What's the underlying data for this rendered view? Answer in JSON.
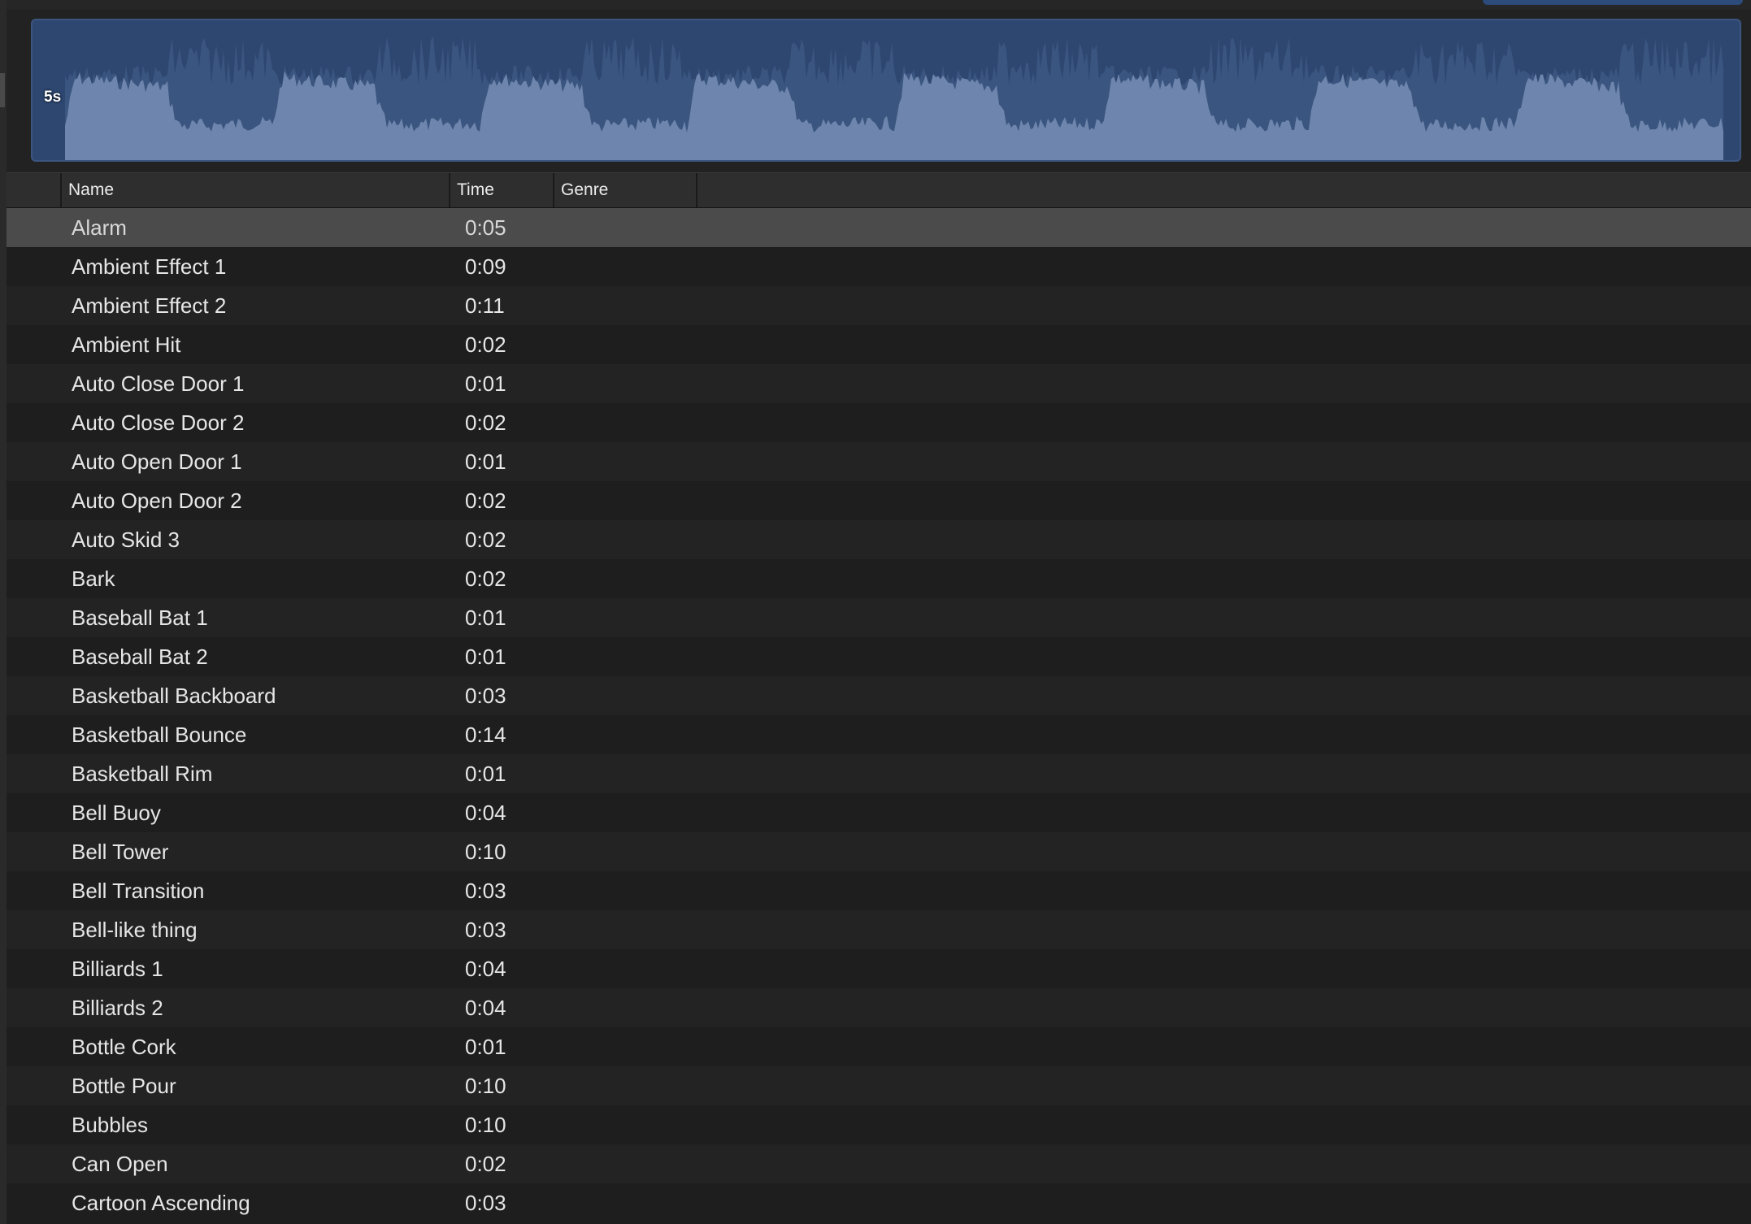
{
  "preview": {
    "duration_label": "5s"
  },
  "columns": {
    "name": "Name",
    "time": "Time",
    "genre": "Genre"
  },
  "selected_index": 0,
  "rows": [
    {
      "name": "Alarm",
      "time": "0:05",
      "genre": ""
    },
    {
      "name": "Ambient Effect 1",
      "time": "0:09",
      "genre": ""
    },
    {
      "name": "Ambient Effect 2",
      "time": "0:11",
      "genre": ""
    },
    {
      "name": "Ambient Hit",
      "time": "0:02",
      "genre": ""
    },
    {
      "name": "Auto Close Door 1",
      "time": "0:01",
      "genre": ""
    },
    {
      "name": "Auto Close Door 2",
      "time": "0:02",
      "genre": ""
    },
    {
      "name": "Auto Open Door 1",
      "time": "0:01",
      "genre": ""
    },
    {
      "name": "Auto Open Door 2",
      "time": "0:02",
      "genre": ""
    },
    {
      "name": "Auto Skid 3",
      "time": "0:02",
      "genre": ""
    },
    {
      "name": "Bark",
      "time": "0:02",
      "genre": ""
    },
    {
      "name": "Baseball Bat 1",
      "time": "0:01",
      "genre": ""
    },
    {
      "name": "Baseball Bat 2",
      "time": "0:01",
      "genre": ""
    },
    {
      "name": "Basketball Backboard",
      "time": "0:03",
      "genre": ""
    },
    {
      "name": "Basketball Bounce",
      "time": "0:14",
      "genre": ""
    },
    {
      "name": "Basketball Rim",
      "time": "0:01",
      "genre": ""
    },
    {
      "name": "Bell Buoy",
      "time": "0:04",
      "genre": ""
    },
    {
      "name": "Bell Tower",
      "time": "0:10",
      "genre": ""
    },
    {
      "name": "Bell Transition",
      "time": "0:03",
      "genre": ""
    },
    {
      "name": "Bell-like thing",
      "time": "0:03",
      "genre": ""
    },
    {
      "name": "Billiards 1",
      "time": "0:04",
      "genre": ""
    },
    {
      "name": "Billiards 2",
      "time": "0:04",
      "genre": ""
    },
    {
      "name": "Bottle Cork",
      "time": "0:01",
      "genre": ""
    },
    {
      "name": "Bottle Pour",
      "time": "0:10",
      "genre": ""
    },
    {
      "name": "Bubbles",
      "time": "0:10",
      "genre": ""
    },
    {
      "name": "Can Open",
      "time": "0:02",
      "genre": ""
    },
    {
      "name": "Cartoon Ascending",
      "time": "0:03",
      "genre": ""
    }
  ],
  "colors": {
    "waveform_bg": "#2d4771",
    "waveform_fill": "#6e86ad",
    "selected_row": "#4b4b4b"
  }
}
